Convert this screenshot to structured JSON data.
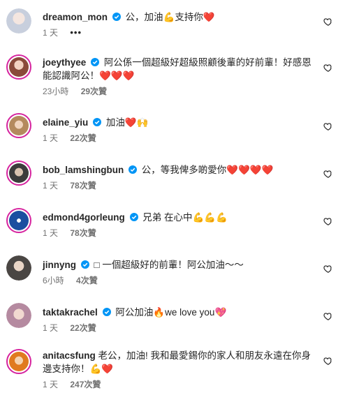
{
  "comments": [
    {
      "username": "dreamon_mon",
      "text": "公，加油💪支持你❤️",
      "time": "1 天",
      "likes": "",
      "more": "•••",
      "avatar_color": "#c8cfdd"
    },
    {
      "username": "joeythyee",
      "text": "阿公係一個超級好超級照顧後輩的好前輩！好感恩能認識阿公！❤️❤️❤️",
      "time": "23小時",
      "likes": "29次贊",
      "avatar_color": "#e6b9a6"
    },
    {
      "username": "elaine_yiu",
      "text": "加油❤️🙌",
      "time": "1 天",
      "likes": "22次贊",
      "avatar_color": "#c9a27f"
    },
    {
      "username": "bob_lamshingbun",
      "text": "公，等我俾多啲愛你❤️❤️❤️❤️",
      "time": "1 天",
      "likes": "78次贊",
      "avatar_color": "#5a5a5a"
    },
    {
      "username": "edmond4gorleung",
      "text": "兄弟 在心中💪💪💪",
      "time": "1 天",
      "likes": "78次贊",
      "avatar_color": "#1b4fa0"
    },
    {
      "username": "jinnyng",
      "text": "□ 一個超級好的前輩！阿公加油～～",
      "time": "6小時",
      "likes": "4次贊",
      "avatar_color": "#6e6a66"
    },
    {
      "username": "taktakrachel",
      "text": "阿公加油🔥we love you💖",
      "time": "1 天",
      "likes": "22次贊",
      "avatar_color": "#b58aa0"
    },
    {
      "username": "anitacsfung",
      "text": "老公，加油! 我和最愛錫你的家人和朋友永遠在你身邊支持你！💪❤️",
      "time": "1 天",
      "likes": "247次贊",
      "avatar_color": "#e07a1f"
    }
  ],
  "colors": {
    "verified": "#0095f6",
    "heart": "#ed1c24",
    "ring": "#d6249f"
  }
}
